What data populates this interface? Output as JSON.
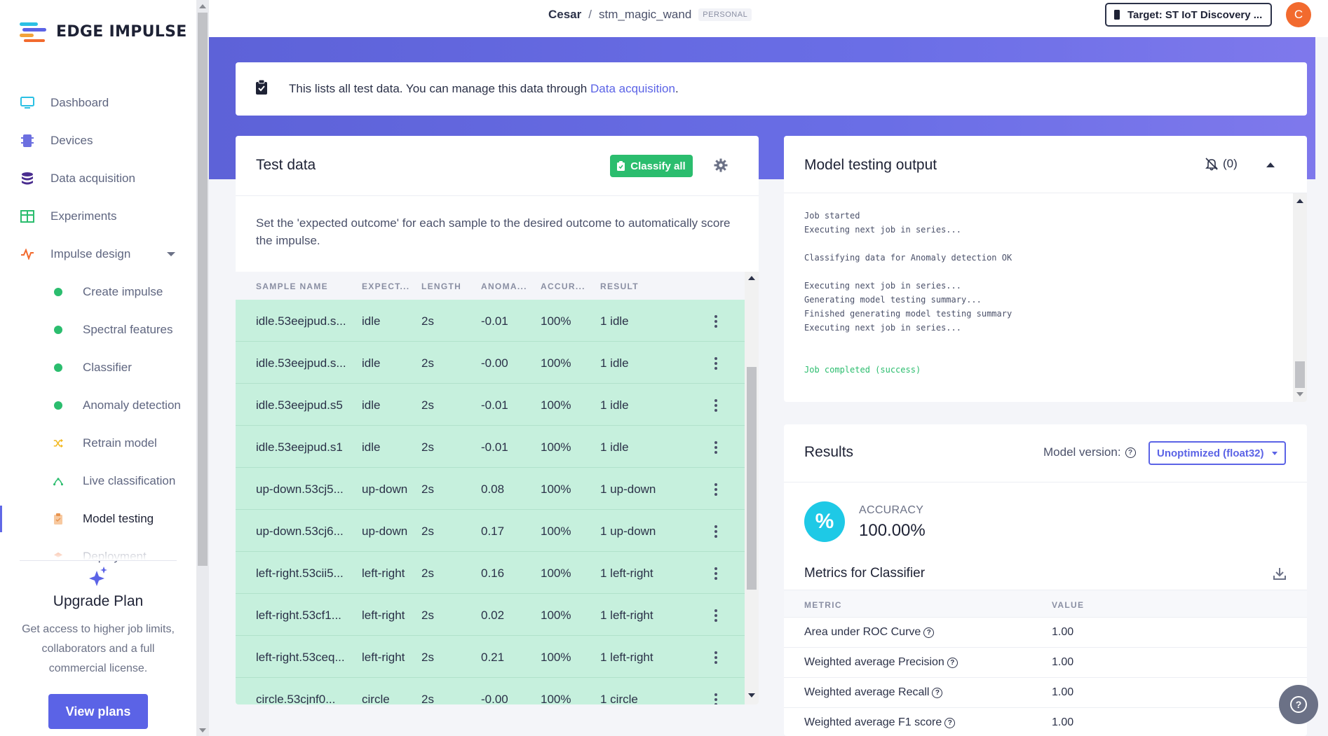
{
  "app": {
    "logo_text": "EDGE IMPULSE",
    "brand_colors": {
      "accent": "#5b63e6",
      "success": "#2bbd6e",
      "orange": "#f26a2e"
    }
  },
  "breadcrumb": {
    "user": "Cesar",
    "separator": "/",
    "project": "stm_magic_wand",
    "badge": "PERSONAL"
  },
  "topbar": {
    "target_label": "Target: ST IoT Discovery ...",
    "avatar_letter": "C"
  },
  "sidebar": {
    "items": [
      {
        "label": "Dashboard",
        "icon": "monitor-icon"
      },
      {
        "label": "Devices",
        "icon": "chip-icon"
      },
      {
        "label": "Data acquisition",
        "icon": "database-icon"
      },
      {
        "label": "Experiments",
        "icon": "grid-icon"
      },
      {
        "label": "Impulse design",
        "icon": "pulse-icon"
      },
      {
        "label": "Create impulse",
        "icon": "dot-icon"
      },
      {
        "label": "Spectral features",
        "icon": "dot-icon"
      },
      {
        "label": "Classifier",
        "icon": "dot-icon"
      },
      {
        "label": "Anomaly detection",
        "icon": "dot-icon"
      },
      {
        "label": "Retrain model",
        "icon": "shuffle-icon"
      },
      {
        "label": "Live classification",
        "icon": "live-icon"
      },
      {
        "label": "Model testing",
        "icon": "clipboard-icon"
      },
      {
        "label": "Deployment",
        "icon": "box-icon"
      }
    ],
    "upgrade": {
      "title": "Upgrade Plan",
      "text": "Get access to higher job limits, collaborators and a full commercial license.",
      "button": "View plans"
    }
  },
  "banner": {
    "text": "This lists all test data. You can manage this data through ",
    "link": "Data acquisition",
    "suffix": "."
  },
  "test_data": {
    "title": "Test data",
    "classify_button": "Classify all",
    "description": "Set the 'expected outcome' for each sample to the desired outcome to automatically score the impulse.",
    "columns": [
      "SAMPLE NAME",
      "EXPECT...",
      "LENGTH",
      "ANOMA...",
      "ACCUR...",
      "RESULT"
    ],
    "rows": [
      [
        "idle.53eejpud.s...",
        "idle",
        "2s",
        "-0.01",
        "100%",
        "1 idle"
      ],
      [
        "idle.53eejpud.s...",
        "idle",
        "2s",
        "-0.00",
        "100%",
        "1 idle"
      ],
      [
        "idle.53eejpud.s5",
        "idle",
        "2s",
        "-0.01",
        "100%",
        "1 idle"
      ],
      [
        "idle.53eejpud.s1",
        "idle",
        "2s",
        "-0.01",
        "100%",
        "1 idle"
      ],
      [
        "up-down.53cj5...",
        "up-down",
        "2s",
        "0.08",
        "100%",
        "1 up-down"
      ],
      [
        "up-down.53cj6...",
        "up-down",
        "2s",
        "0.17",
        "100%",
        "1 up-down"
      ],
      [
        "left-right.53cii5...",
        "left-right",
        "2s",
        "0.16",
        "100%",
        "1 left-right"
      ],
      [
        "left-right.53cf1...",
        "left-right",
        "2s",
        "0.02",
        "100%",
        "1 left-right"
      ],
      [
        "left-right.53ceq...",
        "left-right",
        "2s",
        "0.21",
        "100%",
        "1 left-right"
      ],
      [
        "circle.53cjnf0...",
        "circle",
        "2s",
        "-0.00",
        "100%",
        "1 circle"
      ]
    ]
  },
  "output": {
    "title": "Model testing output",
    "notifications": "(0)",
    "log": [
      {
        "text": "Job started",
        "ok": false
      },
      {
        "text": "Executing next job in series...",
        "ok": false
      },
      {
        "text": "",
        "ok": false
      },
      {
        "text": "Classifying data for Anomaly detection OK",
        "ok": false
      },
      {
        "text": "",
        "ok": false
      },
      {
        "text": "Executing next job in series...",
        "ok": false
      },
      {
        "text": "Generating model testing summary...",
        "ok": false
      },
      {
        "text": "Finished generating model testing summary",
        "ok": false
      },
      {
        "text": "Executing next job in series...",
        "ok": false
      },
      {
        "text": "",
        "ok": false
      },
      {
        "text": "",
        "ok": false
      },
      {
        "text": "Job completed (success)",
        "ok": true
      }
    ]
  },
  "results": {
    "title": "Results",
    "model_version_label": "Model version:",
    "model_version_value": "Unoptimized (float32)",
    "accuracy_label": "ACCURACY",
    "accuracy_value": "100.00%",
    "accuracy_symbol": "%",
    "metrics_title": "Metrics for Classifier",
    "columns": [
      "METRIC",
      "VALUE"
    ],
    "metrics": [
      {
        "name": "Area under ROC Curve",
        "value": "1.00"
      },
      {
        "name": "Weighted average Precision",
        "value": "1.00"
      },
      {
        "name": "Weighted average Recall",
        "value": "1.00"
      },
      {
        "name": "Weighted average F1 score",
        "value": "1.00"
      }
    ]
  }
}
